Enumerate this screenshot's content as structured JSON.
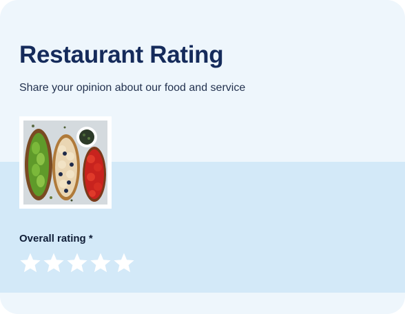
{
  "form": {
    "title": "Restaurant Rating",
    "subtitle": "Share your opinion about our food and service",
    "image_icon": "food-photo",
    "rating_label": "Overall rating *",
    "rating": {
      "max": 5,
      "value": 0,
      "star_icon": "star-icon"
    }
  },
  "colors": {
    "title": "#152b5b",
    "card_background": "#eef6fc",
    "band_background": "#d3e9f8",
    "star_empty": "#ffffff"
  }
}
